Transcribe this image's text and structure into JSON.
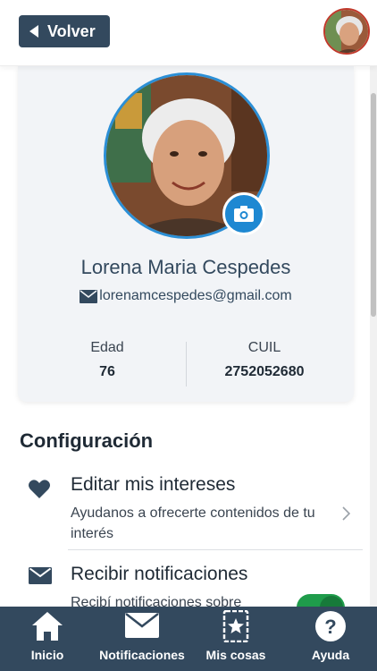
{
  "header": {
    "back_label": "Volver"
  },
  "profile": {
    "name": "Lorena Maria Cespedes",
    "email": "lorenamcespedes@gmail.com",
    "stats": [
      {
        "label": "Edad",
        "value": "76"
      },
      {
        "label": "CUIL",
        "value": "2752052680"
      }
    ]
  },
  "config": {
    "title": "Configuración",
    "items": [
      {
        "icon": "heart-icon",
        "title": "Editar mis intereses",
        "description": "Ayudanos a ofrecerte contenidos de tu interés"
      },
      {
        "icon": "envelope-icon",
        "title": "Recibir notificaciones",
        "description": "Recibí notificaciones sobre",
        "toggle_on": true
      }
    ]
  },
  "nav": [
    {
      "icon": "home-icon",
      "label": "Inicio"
    },
    {
      "icon": "envelope-icon",
      "label": "Notificaciones"
    },
    {
      "icon": "star-bookmark-icon",
      "label": "Mis cosas"
    },
    {
      "icon": "help-icon",
      "label": "Ayuda"
    }
  ],
  "colors": {
    "primary": "#33495e",
    "accent_blue": "#1e88d2",
    "toggle_green": "#1f9c4b"
  }
}
